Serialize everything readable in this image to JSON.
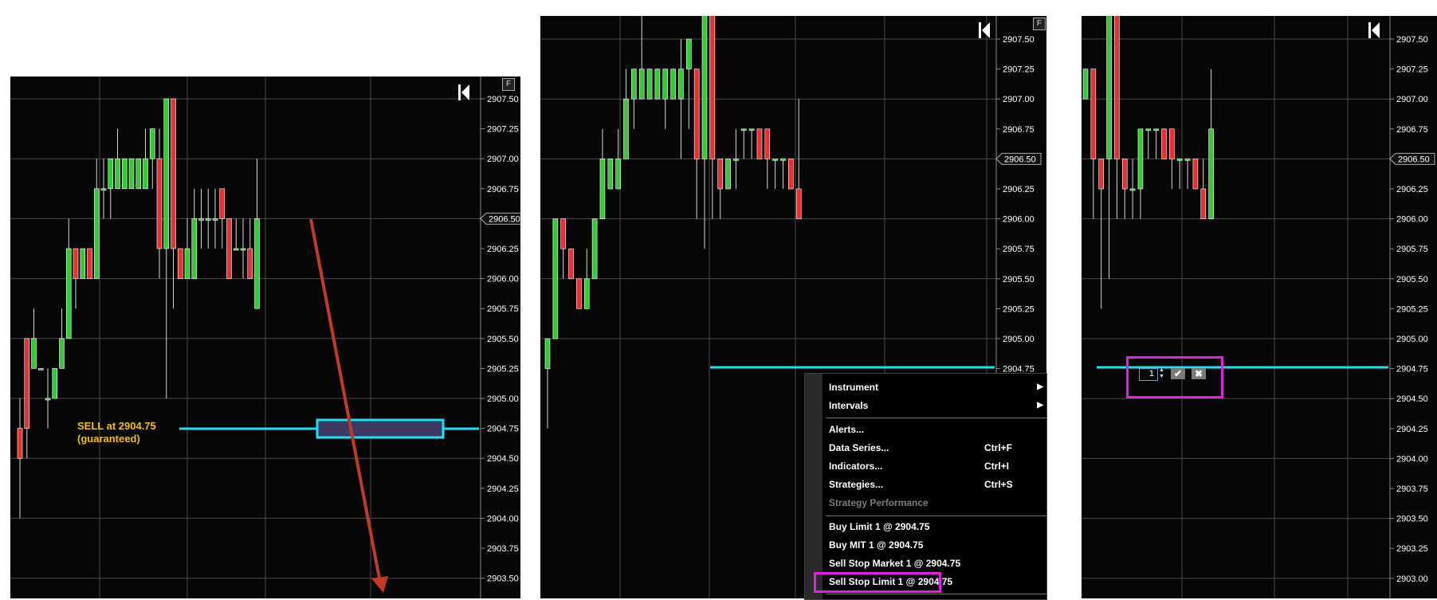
{
  "colors": {
    "background": "#060606",
    "grid": "#4a4a4a",
    "bull": "#36c936",
    "bear": "#e83030",
    "order_line": "#19e3f0",
    "arrow": "#c03a25",
    "highlight": "#e020e0",
    "annotation": "#f2c200",
    "order_box": "#3c3a64"
  },
  "icons": {
    "nav": "skip-to-start-icon",
    "fit": "f-button-icon",
    "confirm": "check-icon",
    "cancel": "x-icon"
  },
  "panels": [
    {
      "id": "p1",
      "fit_label": "F",
      "price_levels": [
        "2907.50",
        "2907.25",
        "2907.00",
        "2906.75",
        "2906.50",
        "2906.25",
        "2906.00",
        "2905.75",
        "2905.50",
        "2905.25",
        "2905.00",
        "2904.75",
        "2904.50",
        "2904.25",
        "2904.00",
        "2903.75",
        "2903.50"
      ],
      "current_price": "2906.50"
    },
    {
      "id": "p2",
      "fit_label": "F",
      "price_levels": [
        "2907.50",
        "2907.25",
        "2907.00",
        "2906.75",
        "2906.50",
        "2906.25",
        "2906.00",
        "2905.75",
        "2905.50",
        "2905.25",
        "2905.00",
        "2904.75"
      ],
      "current_price": "2906.50"
    },
    {
      "id": "p3",
      "fit_label": "",
      "price_levels": [
        "2907.50",
        "2907.25",
        "2907.00",
        "2906.75",
        "2906.50",
        "2906.25",
        "2906.00",
        "2905.75",
        "2905.50",
        "2905.25",
        "2905.00",
        "2904.75",
        "2904.50",
        "2904.25",
        "2904.00",
        "2903.75",
        "2903.50",
        "2903.25",
        "2903.00"
      ],
      "current_price": "2906.50"
    }
  ],
  "annotation": {
    "line1": "SELL at 2904.75",
    "line2": "(guaranteed)"
  },
  "context_menu": {
    "items": [
      {
        "label": "Instrument",
        "shortcut": "",
        "submenu": true,
        "disabled": false
      },
      {
        "label": "Intervals",
        "shortcut": "",
        "submenu": true,
        "disabled": false
      },
      {
        "label": "Alerts...",
        "shortcut": "",
        "submenu": false,
        "disabled": false
      },
      {
        "label": "Data Series...",
        "shortcut": "Ctrl+F",
        "submenu": false,
        "disabled": false
      },
      {
        "label": "Indicators...",
        "shortcut": "Ctrl+I",
        "submenu": false,
        "disabled": false
      },
      {
        "label": "Strategies...",
        "shortcut": "Ctrl+S",
        "submenu": false,
        "disabled": false
      },
      {
        "label": "Strategy Performance",
        "shortcut": "",
        "submenu": false,
        "disabled": true
      },
      {
        "label": "Buy Limit 1 @ 2904.75",
        "shortcut": "",
        "submenu": false,
        "disabled": false
      },
      {
        "label": "Buy MIT 1 @ 2904.75",
        "shortcut": "",
        "submenu": false,
        "disabled": false
      },
      {
        "label": "Sell Stop Market 1 @ 2904.75",
        "shortcut": "",
        "submenu": false,
        "disabled": false
      },
      {
        "label": "Sell Stop Limit 1 @ 2904.75",
        "shortcut": "",
        "submenu": false,
        "disabled": false
      }
    ]
  },
  "quantity_editor": {
    "value": "1"
  },
  "candles": {
    "p1": [
      [
        2904.75,
        2904.5,
        2904.0,
        2905.0
      ],
      [
        2905.5,
        2904.75,
        2904.5,
        2905.5
      ],
      [
        2905.25,
        2905.5,
        2905.25,
        2905.75
      ],
      [
        2905.25,
        2905.25,
        2905.25,
        2905.25
      ],
      [
        2905.0,
        2905.0,
        2904.75,
        2905.25
      ],
      [
        2905.0,
        2905.25,
        2905.0,
        2905.25
      ],
      [
        2905.25,
        2905.5,
        2905.25,
        2905.75
      ],
      [
        2905.5,
        2906.25,
        2905.5,
        2906.5
      ],
      [
        2906.25,
        2906.0,
        2905.75,
        2906.25
      ],
      [
        2906.0,
        2906.25,
        2906.0,
        2906.25
      ],
      [
        2906.25,
        2906.0,
        2906.0,
        2906.25
      ],
      [
        2906.0,
        2906.75,
        2906.0,
        2907.0
      ],
      [
        2906.75,
        2906.75,
        2906.5,
        2907.0
      ],
      [
        2906.75,
        2907.0,
        2906.5,
        2907.0
      ],
      [
        2906.75,
        2907.0,
        2906.75,
        2907.25
      ],
      [
        2906.75,
        2907.0,
        2906.75,
        2907.0
      ],
      [
        2906.75,
        2907.0,
        2906.75,
        2907.0
      ],
      [
        2906.75,
        2907.0,
        2906.75,
        2907.0
      ],
      [
        2906.75,
        2907.0,
        2906.75,
        2907.25
      ],
      [
        2907.0,
        2907.25,
        2906.75,
        2907.25
      ],
      [
        2907.0,
        2906.25,
        2906.0,
        2907.25
      ],
      [
        2906.25,
        2907.5,
        2905.0,
        2907.5
      ],
      [
        2907.5,
        2906.25,
        2905.75,
        2907.5
      ],
      [
        2906.25,
        2906.0,
        2906.0,
        2906.25
      ],
      [
        2906.0,
        2906.25,
        2906.0,
        2906.5
      ],
      [
        2906.0,
        2906.5,
        2906.0,
        2906.75
      ],
      [
        2906.5,
        2906.5,
        2906.25,
        2906.75
      ],
      [
        2906.5,
        2906.5,
        2906.25,
        2906.75
      ],
      [
        2906.5,
        2906.5,
        2906.25,
        2906.75
      ],
      [
        2906.75,
        2906.5,
        2906.25,
        2906.75
      ],
      [
        2906.5,
        2906.0,
        2906.0,
        2906.5
      ],
      [
        2906.25,
        2906.25,
        2906.25,
        2906.5
      ],
      [
        2906.25,
        2906.25,
        2906.0,
        2906.5
      ],
      [
        2906.25,
        2906.0,
        2906.0,
        2906.5
      ],
      [
        2905.75,
        2906.5,
        2905.75,
        2907.0
      ]
    ],
    "p2": [
      [
        2904.75,
        2905.0,
        2904.25,
        2905.0
      ],
      [
        2905.0,
        2906.0,
        2905.0,
        2906.0
      ],
      [
        2906.0,
        2905.75,
        2905.5,
        2906.0
      ],
      [
        2905.75,
        2905.5,
        2905.5,
        2905.75
      ],
      [
        2905.5,
        2905.25,
        2905.25,
        2905.5
      ],
      [
        2905.25,
        2905.5,
        2905.25,
        2905.75
      ],
      [
        2905.5,
        2906.0,
        2905.5,
        2906.0
      ],
      [
        2906.0,
        2906.5,
        2906.0,
        2906.75
      ],
      [
        2906.25,
        2906.5,
        2906.25,
        2906.5
      ],
      [
        2906.25,
        2906.5,
        2906.25,
        2906.75
      ],
      [
        2906.5,
        2907.0,
        2906.5,
        2907.25
      ],
      [
        2907.0,
        2907.25,
        2906.75,
        2907.25
      ],
      [
        2907.0,
        2907.25,
        2907.0,
        2907.75
      ],
      [
        2907.0,
        2907.25,
        2907.0,
        2907.25
      ],
      [
        2907.0,
        2907.25,
        2907.0,
        2907.25
      ],
      [
        2907.0,
        2907.25,
        2906.75,
        2907.25
      ],
      [
        2907.0,
        2907.25,
        2907.0,
        2907.25
      ],
      [
        2907.0,
        2907.25,
        2906.5,
        2907.5
      ],
      [
        2907.25,
        2907.5,
        2906.75,
        2907.5
      ],
      [
        2907.25,
        2906.5,
        2906.0,
        2907.25
      ],
      [
        2906.5,
        2907.75,
        2905.75,
        2907.75
      ],
      [
        2907.75,
        2906.5,
        2906.0,
        2907.75
      ],
      [
        2906.5,
        2906.25,
        2906.0,
        2906.5
      ],
      [
        2906.25,
        2906.5,
        2906.25,
        2906.5
      ],
      [
        2906.5,
        2906.5,
        2906.25,
        2906.75
      ],
      [
        2906.75,
        2906.75,
        2906.5,
        2906.75
      ],
      [
        2906.75,
        2906.75,
        2906.5,
        2906.75
      ],
      [
        2906.75,
        2906.5,
        2906.5,
        2906.75
      ],
      [
        2906.75,
        2906.5,
        2906.25,
        2906.75
      ],
      [
        2906.5,
        2906.5,
        2906.25,
        2906.5
      ],
      [
        2906.5,
        2906.5,
        2906.25,
        2906.5
      ],
      [
        2906.5,
        2906.25,
        2906.25,
        2906.5
      ],
      [
        2906.25,
        2906.0,
        2906.0,
        2907.0
      ]
    ],
    "p3": [
      [
        2907.0,
        2907.25,
        2907.0,
        2907.25
      ],
      [
        2907.25,
        2906.5,
        2906.0,
        2907.25
      ],
      [
        2906.5,
        2906.25,
        2905.25,
        2906.5
      ],
      [
        2906.5,
        2907.75,
        2905.5,
        2907.75
      ],
      [
        2907.75,
        2906.5,
        2906.0,
        2907.75
      ],
      [
        2906.5,
        2906.25,
        2906.0,
        2906.5
      ],
      [
        2906.25,
        2906.25,
        2906.0,
        2906.5
      ],
      [
        2906.25,
        2906.75,
        2906.0,
        2906.75
      ],
      [
        2906.75,
        2906.75,
        2906.5,
        2906.75
      ],
      [
        2906.75,
        2906.75,
        2906.5,
        2906.75
      ],
      [
        2906.75,
        2906.5,
        2906.5,
        2906.75
      ],
      [
        2906.75,
        2906.5,
        2906.25,
        2906.75
      ],
      [
        2906.5,
        2906.5,
        2906.25,
        2906.5
      ],
      [
        2906.5,
        2906.5,
        2906.25,
        2906.5
      ],
      [
        2906.5,
        2906.25,
        2906.25,
        2906.5
      ],
      [
        2906.25,
        2906.0,
        2906.0,
        2906.5
      ],
      [
        2906.0,
        2906.75,
        2906.0,
        2907.25
      ]
    ]
  }
}
